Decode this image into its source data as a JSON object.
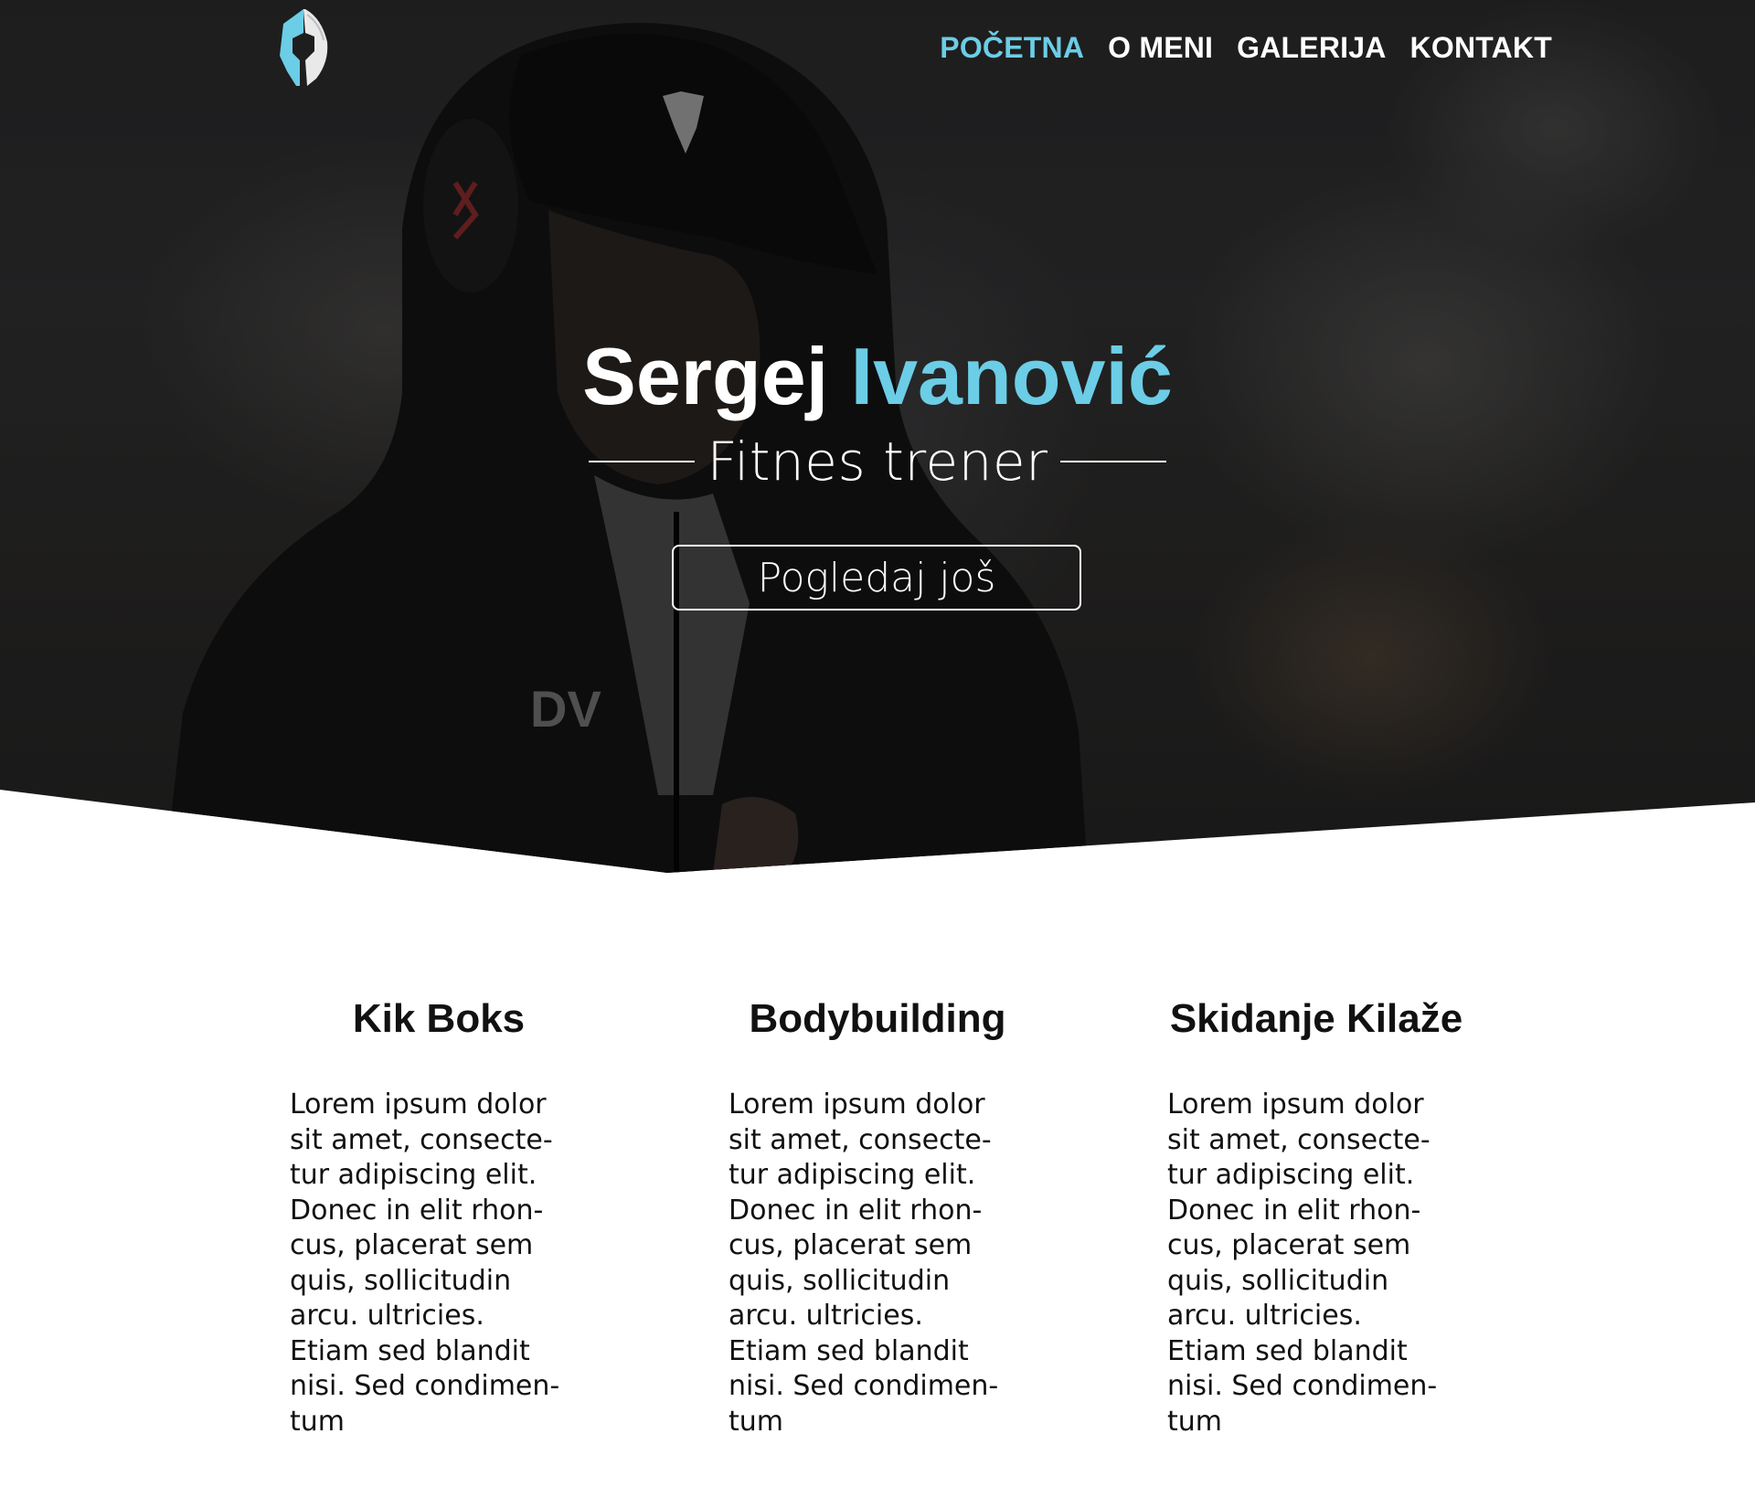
{
  "nav": {
    "logo": "spartan-helmet-logo",
    "items": [
      {
        "label": "POČETNA",
        "active": true
      },
      {
        "label": "O MENI",
        "active": false
      },
      {
        "label": "GALERIJA",
        "active": false
      },
      {
        "label": "KONTAKT",
        "active": false
      }
    ]
  },
  "hero": {
    "first_name": "Sergej",
    "last_name": "Ivanović",
    "subtitle": "Fitnes trener",
    "cta_label": "Pogledaj još"
  },
  "services": [
    {
      "title": "Kik Boks",
      "text": "Lorem ipsum dolor\nsit amet, consecte-\ntur adipiscing elit.\nDonec in elit rhon-\ncus, placerat sem\nquis, sollicitudin\narcu. ultricies.\nEtiam sed blandit\nnisi. Sed condimen-\ntum"
    },
    {
      "title": "Bodybuilding",
      "text": "Lorem ipsum dolor\nsit amet, consecte-\ntur adipiscing elit.\nDonec in elit rhon-\ncus, placerat sem\nquis, sollicitudin\narcu. ultricies.\nEtiam sed blandit\nnisi. Sed condimen-\ntum"
    },
    {
      "title": "Skidanje Kilaže",
      "text": "Lorem ipsum dolor\nsit amet, consecte-\ntur adipiscing elit.\nDonec in elit rhon-\ncus, placerat sem\nquis, sollicitudin\narcu. ultricies.\nEtiam sed blandit\nnisi. Sed condimen-\ntum"
    }
  ],
  "colors": {
    "accent": "#6ccde6",
    "text_dark": "#111111",
    "hero_bg": "#2b2b2c"
  }
}
